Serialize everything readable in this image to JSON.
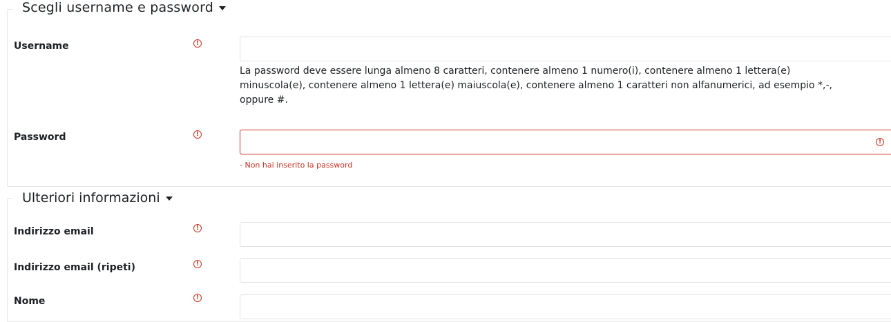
{
  "sections": [
    {
      "legend": "Scegli username e password"
    },
    {
      "legend": "Ulteriori informazioni"
    }
  ],
  "fields": {
    "username": {
      "label": "Username",
      "value": ""
    },
    "password": {
      "label": "Password",
      "value": "",
      "help": "La password deve essere lunga almeno 8 caratteri, contenere almeno 1 numero(i), contenere almeno 1 lettera(e) minuscola(e), contenere almeno 1 lettera(e) maiuscola(e), contenere almeno 1 caratteri non alfanumerici, ad esempio *,-, oppure #.",
      "error": "- Non hai inserito la password"
    },
    "email": {
      "label": "Indirizzo email",
      "value": ""
    },
    "email2": {
      "label": "Indirizzo email (ripeti)",
      "value": ""
    },
    "firstname": {
      "label": "Nome",
      "value": ""
    }
  },
  "icons": {
    "required": "exclamation-circle-icon",
    "caret": "caret-down-icon"
  },
  "colors": {
    "error": "#ca3120",
    "border": "#dee2e6",
    "text": "#1d2125"
  }
}
